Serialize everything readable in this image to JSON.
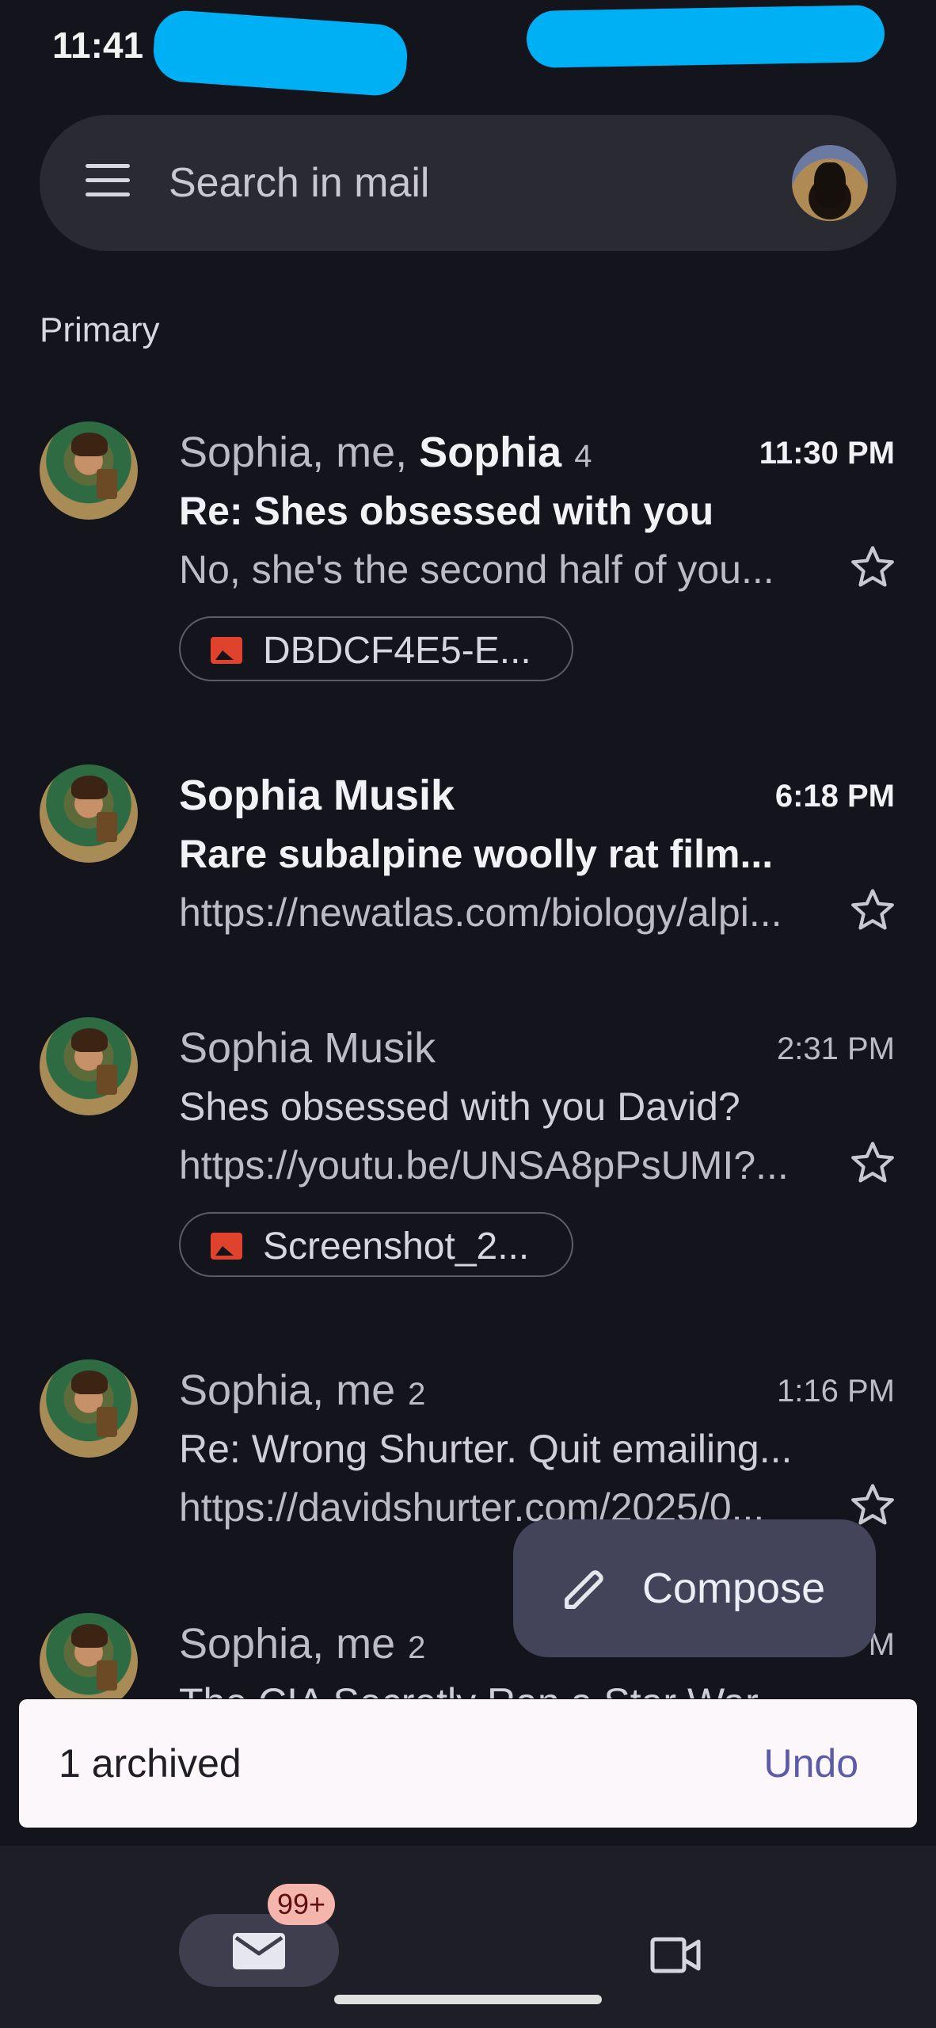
{
  "status": {
    "time": "11:41"
  },
  "search": {
    "placeholder": "Search in mail"
  },
  "section": {
    "label": "Primary"
  },
  "emails": [
    {
      "sender_prefix": "Sophia, me, ",
      "sender_bold": "Sophia",
      "count": "4",
      "time": "11:30 PM",
      "subject": "Re: Shes obsessed with you",
      "snippet": "No, she's the second half of you...",
      "attachment": "DBDCF4E5-E...",
      "starred": false,
      "unread": true
    },
    {
      "sender": "Sophia Musik",
      "time": "6:18 PM",
      "subject": "Rare subalpine woolly rat film...",
      "snippet": "https://newatlas.com/biology/alpi...",
      "starred": false,
      "unread": true
    },
    {
      "sender": "Sophia Musik",
      "time": "2:31 PM",
      "subject": "Shes obsessed with you David?",
      "snippet": "https://youtu.be/UNSA8pPsUMI?...",
      "attachment": "Screenshot_2...",
      "starred": false,
      "unread": false
    },
    {
      "sender": "Sophia, me",
      "count": "2",
      "time": "1:16 PM",
      "subject": "Re: Wrong Shurter. Quit emailing...",
      "snippet": "https://davidshurter.com/2025/0...",
      "starred": false,
      "unread": false
    },
    {
      "sender": "Sophia, me",
      "count": "2",
      "time": "M",
      "subject": "The CIA Secretly Ran a Star War...",
      "unread": false
    }
  ],
  "compose": {
    "label": "Compose"
  },
  "snackbar": {
    "message": "1 archived",
    "action": "Undo"
  },
  "nav": {
    "mail_badge": "99+"
  },
  "colors": {
    "background": "#14141c",
    "snackbar": "#fbf7fb",
    "accent": "#5b5ba8",
    "badge": "#f4b5ad",
    "redaction": "#00b0f5"
  }
}
